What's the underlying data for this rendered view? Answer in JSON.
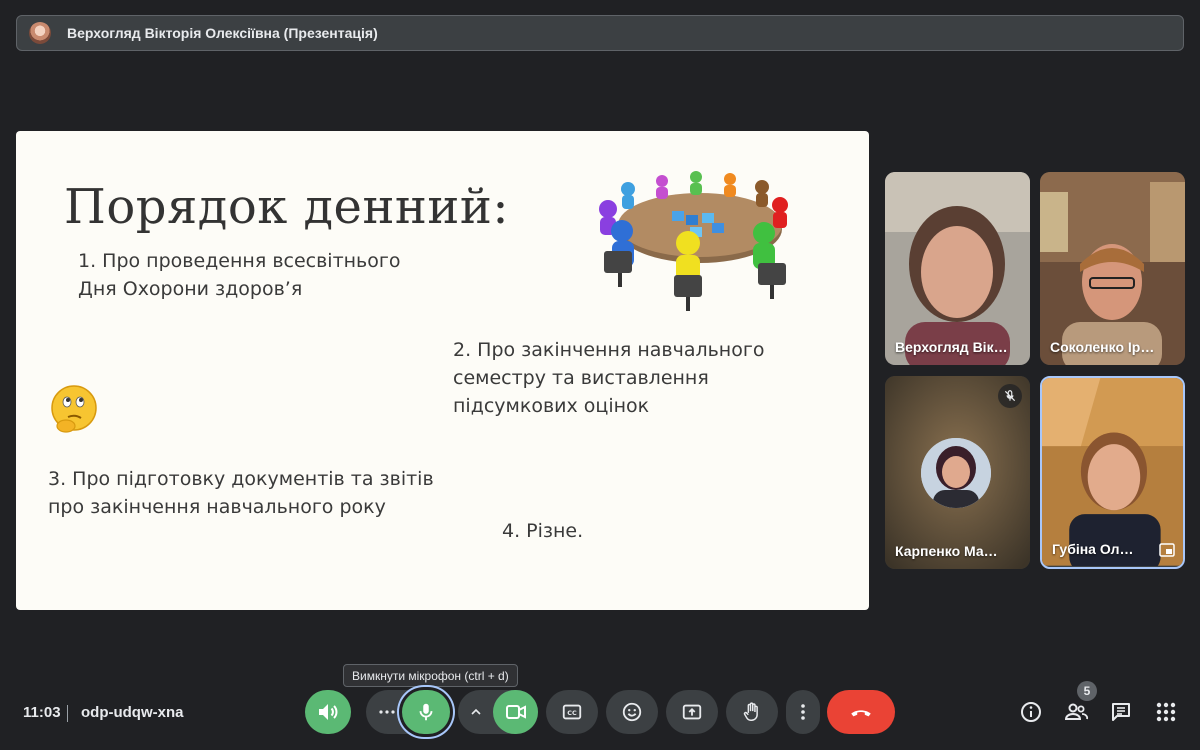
{
  "presenter": {
    "name": "Верхогляд Вікторія Олексіївна (Презентація)"
  },
  "slide": {
    "title": "Порядок денний:",
    "item1": "1. Про проведення всесвітнього Дня Охорони здоров’я",
    "item2": "2.     Про закінчення навчального семестру та виставлення підсумкових оцінок",
    "item3": "3.  Про підготовку документів та звітів про закінчення навчального року",
    "item4": "4.    Різне."
  },
  "participants": [
    {
      "name": "Верхогляд Вік…"
    },
    {
      "name": "Соколенко Ір…"
    },
    {
      "name": "Карпенко Ма…",
      "muted": true
    },
    {
      "name": "Губіна Ол…",
      "active_speaker": true
    }
  ],
  "tooltip": {
    "text": "Вимкнути мікрофон (ctrl + d)"
  },
  "bottom": {
    "time": "11:03",
    "meeting_code": "odp-udqw-xna",
    "people_count": "5"
  },
  "icons": {
    "volume": "volume-icon",
    "more_audio": "more-horizontal-icon",
    "mic": "mic-icon",
    "chevron": "chevron-up-icon",
    "camera": "videocam-icon",
    "captions": "closed-caption-icon",
    "emoji": "emoji-icon",
    "present": "present-screen-icon",
    "hand": "raise-hand-icon",
    "more": "more-vertical-icon",
    "leave": "call-end-icon",
    "info": "info-icon",
    "people": "people-icon",
    "chat": "chat-icon",
    "activities": "apps-grid-icon"
  },
  "colors": {
    "background": "#202124",
    "active_green": "#5bb974",
    "leave_red": "#ea4335",
    "focus_ring": "#a8c7fa",
    "slide_bg": "#fdfcf7"
  }
}
